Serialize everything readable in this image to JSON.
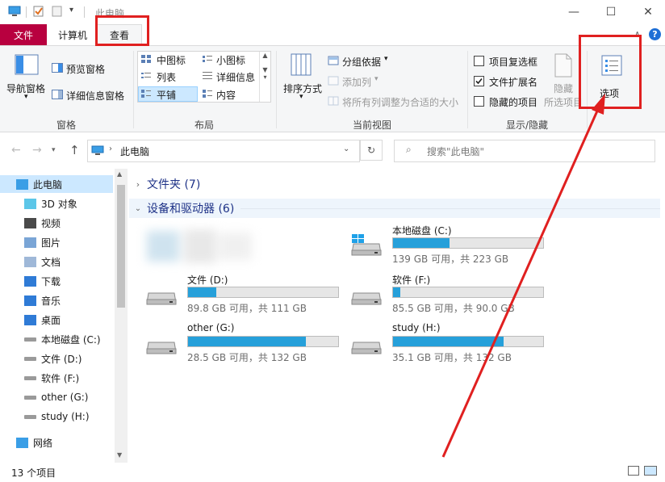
{
  "window": {
    "title": "此电脑"
  },
  "ribbon_tabs": [
    {
      "label": "文件"
    },
    {
      "label": "计算机"
    },
    {
      "label": "查看"
    }
  ],
  "ribbon": {
    "panes": {
      "nav_pane": "导航窗格",
      "preview_pane": "预览窗格",
      "details_pane": "详细信息窗格",
      "group": "窗格"
    },
    "layout": {
      "medium_icons": "中图标",
      "small_icons": "小图标",
      "list": "列表",
      "details": "详细信息",
      "tiles": "平铺",
      "content": "内容",
      "group": "布局"
    },
    "current_view": {
      "sort_by": "排序方式",
      "group_by": "分组依据",
      "add_columns": "添加列",
      "size_all_columns": "将所有列调整为合适的大小",
      "group": "当前视图"
    },
    "show_hide": {
      "item_checkboxes": "项目复选框",
      "file_extensions": "文件扩展名",
      "hidden_items": "隐藏的项目",
      "hide": "隐藏",
      "hide_selected": "所选项目",
      "group": "显示/隐藏",
      "file_extensions_checked": true
    },
    "options": {
      "label": "选项"
    }
  },
  "address": {
    "path": "此电脑",
    "search_placeholder": "搜索\"此电脑\""
  },
  "nav_items": [
    {
      "label": "此电脑",
      "icon": "pc-icon"
    },
    {
      "label": "3D 对象",
      "icon": "3d-objects-icon"
    },
    {
      "label": "视频",
      "icon": "video-icon"
    },
    {
      "label": "图片",
      "icon": "pictures-icon"
    },
    {
      "label": "文档",
      "icon": "documents-icon"
    },
    {
      "label": "下载",
      "icon": "download-icon"
    },
    {
      "label": "音乐",
      "icon": "music-icon"
    },
    {
      "label": "桌面",
      "icon": "desktop-icon"
    },
    {
      "label": "本地磁盘 (C:)",
      "icon": "drive-icon"
    },
    {
      "label": "文件 (D:)",
      "icon": "drive-icon"
    },
    {
      "label": "软件 (F:)",
      "icon": "drive-icon"
    },
    {
      "label": "other (G:)",
      "icon": "drive-icon"
    },
    {
      "label": "study (H:)",
      "icon": "drive-icon"
    },
    {
      "label": "网络",
      "icon": "network-icon"
    }
  ],
  "sections": {
    "folders": "文件夹 (7)",
    "devices": "设备和驱动器 (6)"
  },
  "drives": [
    {
      "name": "本地磁盘 (C:)",
      "info": "139 GB 可用，共 223 GB",
      "used_fraction": 0.377
    },
    {
      "name": "文件 (D:)",
      "info": "89.8 GB 可用，共 111 GB",
      "used_fraction": 0.19
    },
    {
      "name": "软件 (F:)",
      "info": "85.5 GB 可用，共 90.0 GB",
      "used_fraction": 0.05
    },
    {
      "name": "other (G:)",
      "info": "28.5 GB 可用，共 132 GB",
      "used_fraction": 0.784
    },
    {
      "name": "study (H:)",
      "info": "35.1 GB 可用，共 132 GB",
      "used_fraction": 0.734
    }
  ],
  "status": {
    "count": "13 个项目"
  },
  "colors": {
    "accent": "#26a0da",
    "file_tab": "#b8003f",
    "annotation": "#e02020",
    "section_header": "#1e3287"
  }
}
